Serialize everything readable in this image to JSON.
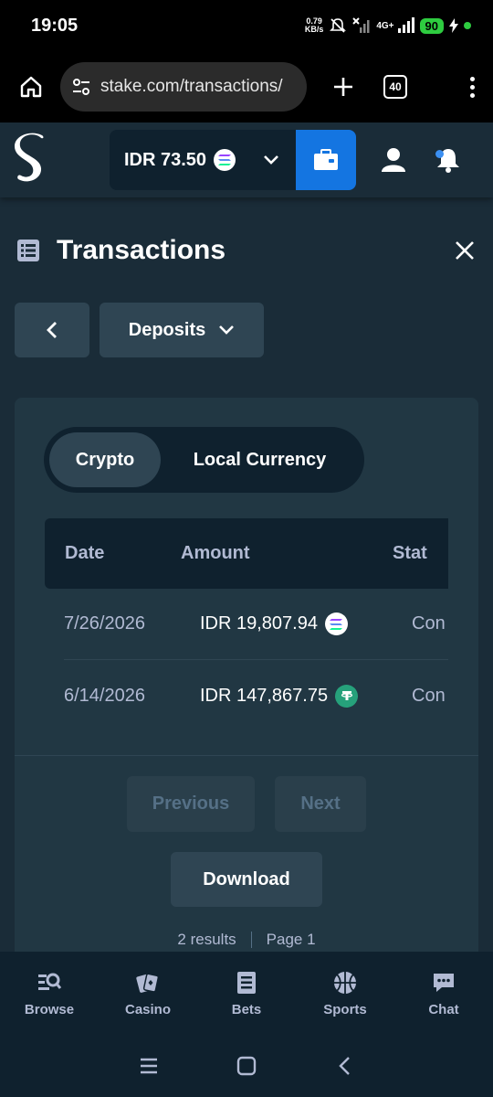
{
  "status_bar": {
    "time": "19:05",
    "net_speed_value": "0.79",
    "net_speed_unit": "KB/s",
    "network": "4G+",
    "battery": "90"
  },
  "browser": {
    "url": "stake.com/transactions/",
    "tab_count": "40"
  },
  "header": {
    "balance": "IDR 73.50",
    "coin_icon": "solana-icon"
  },
  "page": {
    "title": "Transactions"
  },
  "nav": {
    "filter_label": "Deposits"
  },
  "toggle": {
    "options": [
      "Crypto",
      "Local Currency"
    ],
    "active": "Crypto"
  },
  "table": {
    "columns": [
      "Date",
      "Amount",
      "Stat"
    ],
    "rows": [
      {
        "date": "7/26/2026",
        "amount": "IDR 19,807.94",
        "coin": "solana-icon",
        "status": "Con"
      },
      {
        "date": "6/14/2026",
        "amount": "IDR 147,867.75",
        "coin": "tether-icon",
        "status": "Con"
      }
    ]
  },
  "pagination": {
    "previous_label": "Previous",
    "next_label": "Next",
    "download_label": "Download",
    "results": "2 results",
    "page": "Page 1"
  },
  "bottom_nav": {
    "items": [
      "Browse",
      "Casino",
      "Bets",
      "Sports",
      "Chat"
    ]
  },
  "colors": {
    "background": "#1a2c38",
    "card": "#213743",
    "dark": "#0f212e",
    "button": "#2f4553",
    "accent": "#1475e1",
    "muted_text": "#b1bad3"
  }
}
